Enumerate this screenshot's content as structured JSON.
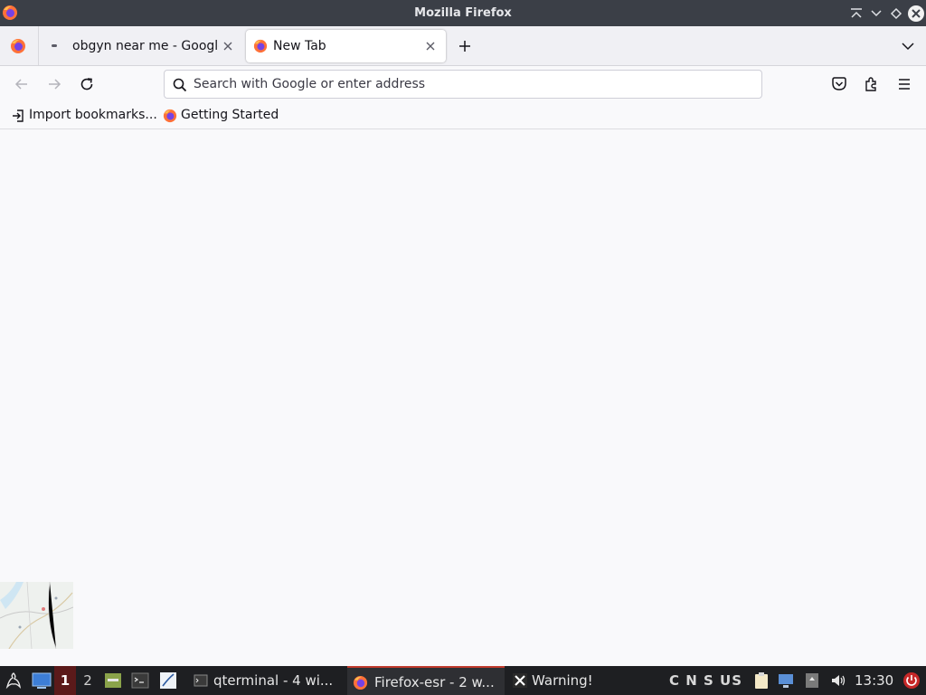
{
  "window": {
    "title": "Mozilla Firefox"
  },
  "tabs": [
    {
      "label": "obgyn near me - Google Search",
      "active": false
    },
    {
      "label": "New Tab",
      "active": true
    }
  ],
  "urlbar": {
    "placeholder": "Search with Google or enter address",
    "value": ""
  },
  "bookmarks": [
    {
      "label": "Import bookmarks...",
      "icon": "import-icon"
    },
    {
      "label": "Getting Started",
      "icon": "firefox-icon"
    }
  ],
  "taskbar": {
    "workspaces": [
      "1",
      "2"
    ],
    "tasks": [
      {
        "label": "qterminal - 4 wi...",
        "icon": "terminal-icon"
      },
      {
        "label": "Firefox-esr - 2 w...",
        "icon": "firefox-icon",
        "active": true
      },
      {
        "label": "Warning!",
        "icon": "x-icon"
      }
    ],
    "keyboard": "C N S US",
    "clock": "13:30"
  },
  "colors": {
    "titlebar": "#3b3f47",
    "tabstrip": "#f0f0f4",
    "content": "#f9f9fb",
    "taskbar": "#1e1f22",
    "active_workspace": "#5b1a1a",
    "active_task_accent": "#c0392b"
  }
}
